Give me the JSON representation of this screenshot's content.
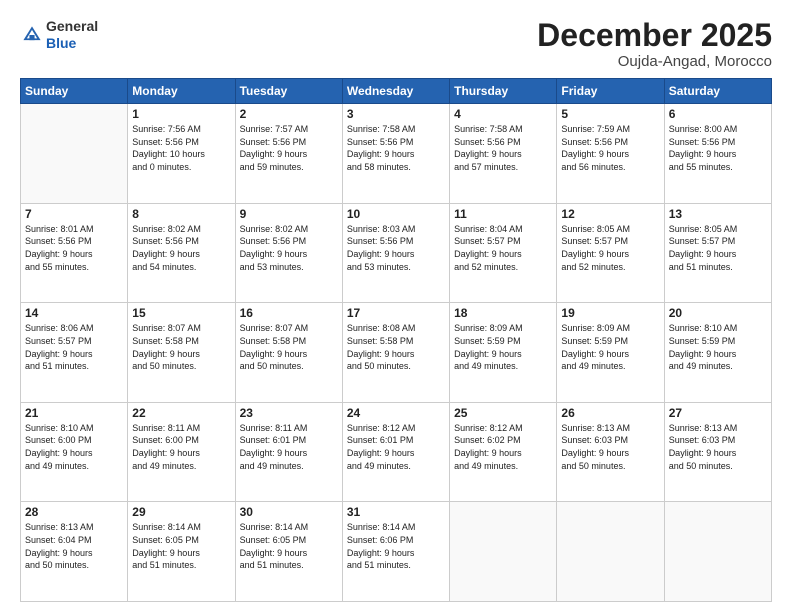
{
  "header": {
    "logo_general": "General",
    "logo_blue": "Blue",
    "month_title": "December 2025",
    "location": "Oujda-Angad, Morocco"
  },
  "days_of_week": [
    "Sunday",
    "Monday",
    "Tuesday",
    "Wednesday",
    "Thursday",
    "Friday",
    "Saturday"
  ],
  "weeks": [
    [
      {
        "day": "",
        "info": ""
      },
      {
        "day": "1",
        "info": "Sunrise: 7:56 AM\nSunset: 5:56 PM\nDaylight: 10 hours\nand 0 minutes."
      },
      {
        "day": "2",
        "info": "Sunrise: 7:57 AM\nSunset: 5:56 PM\nDaylight: 9 hours\nand 59 minutes."
      },
      {
        "day": "3",
        "info": "Sunrise: 7:58 AM\nSunset: 5:56 PM\nDaylight: 9 hours\nand 58 minutes."
      },
      {
        "day": "4",
        "info": "Sunrise: 7:58 AM\nSunset: 5:56 PM\nDaylight: 9 hours\nand 57 minutes."
      },
      {
        "day": "5",
        "info": "Sunrise: 7:59 AM\nSunset: 5:56 PM\nDaylight: 9 hours\nand 56 minutes."
      },
      {
        "day": "6",
        "info": "Sunrise: 8:00 AM\nSunset: 5:56 PM\nDaylight: 9 hours\nand 55 minutes."
      }
    ],
    [
      {
        "day": "7",
        "info": "Sunrise: 8:01 AM\nSunset: 5:56 PM\nDaylight: 9 hours\nand 55 minutes."
      },
      {
        "day": "8",
        "info": "Sunrise: 8:02 AM\nSunset: 5:56 PM\nDaylight: 9 hours\nand 54 minutes."
      },
      {
        "day": "9",
        "info": "Sunrise: 8:02 AM\nSunset: 5:56 PM\nDaylight: 9 hours\nand 53 minutes."
      },
      {
        "day": "10",
        "info": "Sunrise: 8:03 AM\nSunset: 5:56 PM\nDaylight: 9 hours\nand 53 minutes."
      },
      {
        "day": "11",
        "info": "Sunrise: 8:04 AM\nSunset: 5:57 PM\nDaylight: 9 hours\nand 52 minutes."
      },
      {
        "day": "12",
        "info": "Sunrise: 8:05 AM\nSunset: 5:57 PM\nDaylight: 9 hours\nand 52 minutes."
      },
      {
        "day": "13",
        "info": "Sunrise: 8:05 AM\nSunset: 5:57 PM\nDaylight: 9 hours\nand 51 minutes."
      }
    ],
    [
      {
        "day": "14",
        "info": "Sunrise: 8:06 AM\nSunset: 5:57 PM\nDaylight: 9 hours\nand 51 minutes."
      },
      {
        "day": "15",
        "info": "Sunrise: 8:07 AM\nSunset: 5:58 PM\nDaylight: 9 hours\nand 50 minutes."
      },
      {
        "day": "16",
        "info": "Sunrise: 8:07 AM\nSunset: 5:58 PM\nDaylight: 9 hours\nand 50 minutes."
      },
      {
        "day": "17",
        "info": "Sunrise: 8:08 AM\nSunset: 5:58 PM\nDaylight: 9 hours\nand 50 minutes."
      },
      {
        "day": "18",
        "info": "Sunrise: 8:09 AM\nSunset: 5:59 PM\nDaylight: 9 hours\nand 49 minutes."
      },
      {
        "day": "19",
        "info": "Sunrise: 8:09 AM\nSunset: 5:59 PM\nDaylight: 9 hours\nand 49 minutes."
      },
      {
        "day": "20",
        "info": "Sunrise: 8:10 AM\nSunset: 5:59 PM\nDaylight: 9 hours\nand 49 minutes."
      }
    ],
    [
      {
        "day": "21",
        "info": "Sunrise: 8:10 AM\nSunset: 6:00 PM\nDaylight: 9 hours\nand 49 minutes."
      },
      {
        "day": "22",
        "info": "Sunrise: 8:11 AM\nSunset: 6:00 PM\nDaylight: 9 hours\nand 49 minutes."
      },
      {
        "day": "23",
        "info": "Sunrise: 8:11 AM\nSunset: 6:01 PM\nDaylight: 9 hours\nand 49 minutes."
      },
      {
        "day": "24",
        "info": "Sunrise: 8:12 AM\nSunset: 6:01 PM\nDaylight: 9 hours\nand 49 minutes."
      },
      {
        "day": "25",
        "info": "Sunrise: 8:12 AM\nSunset: 6:02 PM\nDaylight: 9 hours\nand 49 minutes."
      },
      {
        "day": "26",
        "info": "Sunrise: 8:13 AM\nSunset: 6:03 PM\nDaylight: 9 hours\nand 50 minutes."
      },
      {
        "day": "27",
        "info": "Sunrise: 8:13 AM\nSunset: 6:03 PM\nDaylight: 9 hours\nand 50 minutes."
      }
    ],
    [
      {
        "day": "28",
        "info": "Sunrise: 8:13 AM\nSunset: 6:04 PM\nDaylight: 9 hours\nand 50 minutes."
      },
      {
        "day": "29",
        "info": "Sunrise: 8:14 AM\nSunset: 6:05 PM\nDaylight: 9 hours\nand 51 minutes."
      },
      {
        "day": "30",
        "info": "Sunrise: 8:14 AM\nSunset: 6:05 PM\nDaylight: 9 hours\nand 51 minutes."
      },
      {
        "day": "31",
        "info": "Sunrise: 8:14 AM\nSunset: 6:06 PM\nDaylight: 9 hours\nand 51 minutes."
      },
      {
        "day": "",
        "info": ""
      },
      {
        "day": "",
        "info": ""
      },
      {
        "day": "",
        "info": ""
      }
    ]
  ]
}
